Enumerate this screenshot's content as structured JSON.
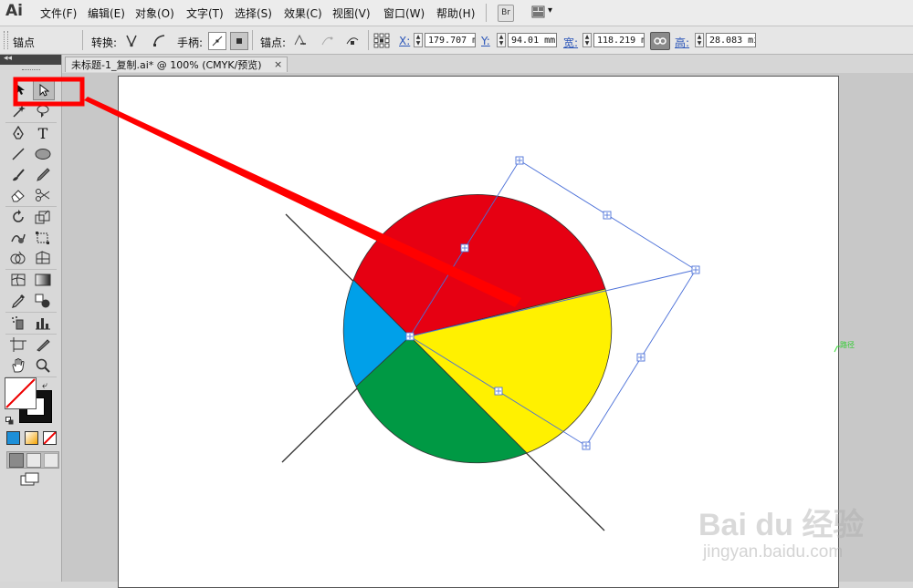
{
  "app": {
    "logo": "Ai"
  },
  "menu": {
    "items": [
      "文件(F)",
      "编辑(E)",
      "对象(O)",
      "文字(T)",
      "选择(S)",
      "效果(C)",
      "视图(V)",
      "窗口(W)",
      "帮助(H)"
    ],
    "bridge_label": "Br",
    "arrange_label": "▾"
  },
  "control": {
    "mode_label": "锚点",
    "convert_label": "转换:",
    "handles_label": "手柄:",
    "anchor_label": "锚点:",
    "x_label": "X:",
    "x_value": "179.707 m",
    "y_label": "Y:",
    "y_value": "94.01 mm",
    "w_label": "宽:",
    "w_value": "118.219 m",
    "h_label": "高:",
    "h_value": "28.083 mi"
  },
  "document": {
    "tab_title": "未标题-1_复制.ai* @ 100% (CMYK/预览)",
    "close": "×"
  },
  "artwork": {
    "colors": {
      "red": "#e60012",
      "yellow": "#fff100",
      "green": "#009944",
      "blue": "#00a0e9",
      "selection": "#4a6fd8",
      "annotation": "#ff0000"
    },
    "smart_guide_label": "路径"
  },
  "watermark": {
    "brand": "Bai du 经验",
    "url": "jingyan.baidu.com"
  },
  "icons": [
    "selection-tool-icon",
    "direct-selection-icon",
    "pen-icon",
    "type-icon",
    "line-icon",
    "ellipse-icon",
    "brush-icon",
    "pencil-icon",
    "eraser-icon",
    "scissors-icon",
    "rotate-icon",
    "scale-icon",
    "warp-icon",
    "free-transform-icon",
    "shape-builder-icon",
    "perspective-icon",
    "mesh-icon",
    "gradient-icon",
    "eyedropper-icon",
    "blend-icon",
    "symbol-sprayer-icon",
    "graph-icon",
    "artboard-icon",
    "slice-icon",
    "hand-icon",
    "zoom-icon"
  ]
}
